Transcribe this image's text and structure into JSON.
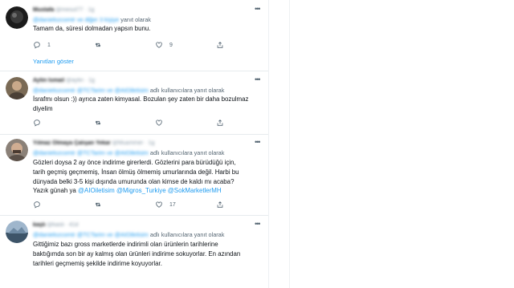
{
  "tweets": [
    {
      "name": "Mustafa",
      "handle": "@mesut77 · 1g",
      "reply_prefix": "@danielozcomtr ve diğer 3 kişiye",
      "reply_suffix": "yanıt olarak",
      "lines": [
        "Tamam da, süresi dolmadan yapsın bunu."
      ],
      "counts": {
        "reply": "1",
        "retweet": "",
        "like": "9"
      },
      "show_replies": "Yanıtları göster"
    },
    {
      "name": "Aytin Ismail",
      "handle": "@aytin · 1g",
      "reply_prefix": "@danielozcomtr @TCTarim ve @AIOiletisim",
      "reply_suffix": "adlı kullanıcılara yanıt olarak",
      "lines": [
        "İsrafmı olsun :)) ayrıca zaten kimyasal. Bozulan şey zaten bir daha bozulmaz",
        "diyelim"
      ],
      "counts": {
        "reply": "",
        "retweet": "",
        "like": ""
      }
    },
    {
      "name": "Yılmaz Olmaya Çalışan Yekar",
      "handle": "@Muammer · 1g",
      "reply_prefix": "@danielozcomtr @TCTarim ve @AIOiletisim",
      "reply_suffix": "adlı kullanıcılara yanıt olarak",
      "lines": [
        "Gözleri doysa 2 ay önce indirime girerlerdi. Gözlerini para bürüdüğü için,",
        "tarih geçmiş geçmemiş, İnsan ölmüş ölmemiş umurlarında değil. Harbi bu",
        "dünyada belki 3-5 kişi dışında umurunda olan kimse de kaldı mı acaba?"
      ],
      "last_line_prefix": "Yazık günah ya",
      "last_line_mentions": [
        "@AIOiletisim",
        "@Migros_Turkiye",
        "@SokMarketlerMH"
      ],
      "counts": {
        "reply": "",
        "retweet": "",
        "like": "17"
      }
    },
    {
      "name": "kaşlı",
      "handle": "@kasli · 41d",
      "reply_prefix": "@danielozcomtr @TCTarim ve @AIOiletisim",
      "reply_suffix": "adlı kullanıcılara yanıt olarak",
      "lines": [
        "Gittiğimiz bazı gross marketlerde indirimli olan ürünlerin tarihlerine",
        "baktığımda son bir ay kalmış olan ürünleri indirime sokuyorlar. En azından",
        "tarihleri geçmemiş şekilde indirime koyuyorlar."
      ],
      "counts": {
        "reply": "",
        "retweet": "",
        "like": ""
      }
    }
  ],
  "icons": {
    "more": "more-dots-icon",
    "reply": "reply-icon",
    "retweet": "retweet-icon",
    "like": "heart-icon",
    "share": "share-icon"
  },
  "colors": {
    "link": "#1d9bf0",
    "text": "#0f1419",
    "muted": "#536471"
  }
}
